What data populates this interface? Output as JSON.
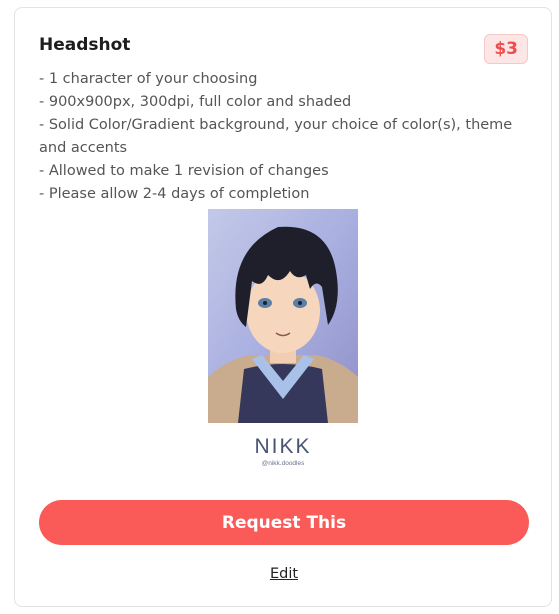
{
  "product": {
    "title": "Headshot",
    "price": "$3",
    "description": [
      "- 1 character of your choosing",
      "- 900x900px, 300dpi, full color and shaded",
      "- Solid Color/Gradient background, your choice of color(s), theme and accents",
      "- Allowed to make 1 revision of changes",
      "- Please allow 2-4 days of completion"
    ],
    "image": {
      "signature": "NIKK",
      "handle": "@nikk.doodles"
    }
  },
  "actions": {
    "request_label": "Request This",
    "edit_label": "Edit"
  },
  "colors": {
    "accent": "#fa5a58",
    "price_text": "#ef4d4d",
    "price_bg": "#fde6e6"
  }
}
